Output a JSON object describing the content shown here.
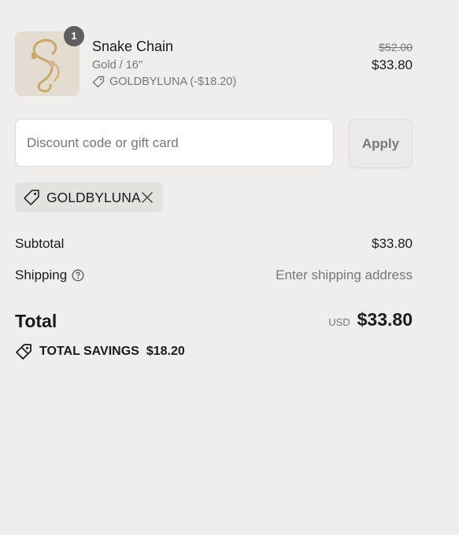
{
  "line_item": {
    "name": "Snake Chain",
    "variant": "Gold / 16''",
    "discount": "GOLDBYLUNA (-$18.20)",
    "quantity": "1",
    "price_original": "$52.00",
    "price_final": "$33.80",
    "thumbnail_icon": "gold-chain-product-photo"
  },
  "discount_form": {
    "placeholder": "Discount code or gift card",
    "value": "",
    "apply_label": "Apply"
  },
  "applied_code": {
    "label": "GOLDBYLUNA"
  },
  "summary": {
    "subtotal_label": "Subtotal",
    "subtotal_value": "$33.80",
    "shipping_label": "Shipping",
    "shipping_value": "Enter shipping address",
    "total_label": "Total",
    "currency": "USD",
    "total_value": "$33.80",
    "savings_label": "TOTAL SAVINGS",
    "savings_value": "$18.20"
  },
  "colors": {
    "background": "#efeeec",
    "badge": "#5e5e5e",
    "muted_text": "#777777"
  }
}
